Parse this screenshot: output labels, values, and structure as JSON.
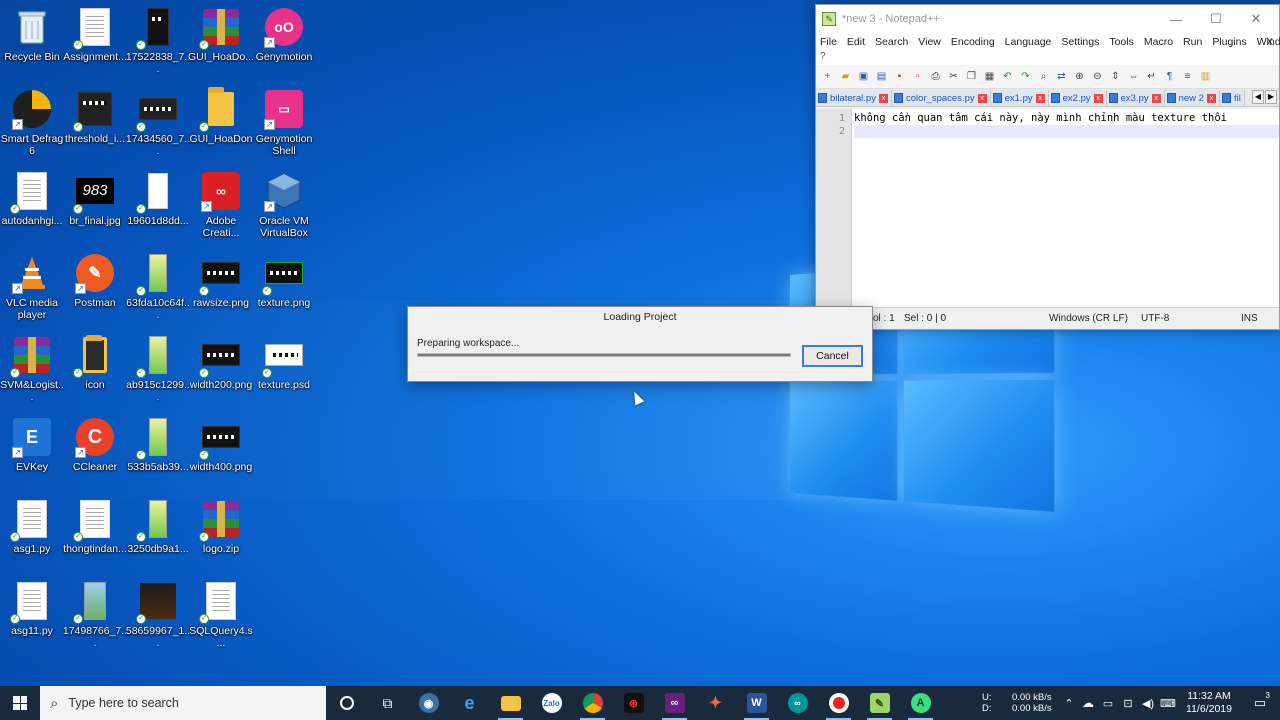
{
  "desktop": {
    "icons": [
      {
        "label": "Recycle Bin"
      },
      {
        "label": "Assignment..."
      },
      {
        "label": "17522838_7..."
      },
      {
        "label": "GUI_HoaDo..."
      },
      {
        "label": "Genymotion"
      },
      {
        "label": "Smart Defrag 6"
      },
      {
        "label": "threshold_i..."
      },
      {
        "label": "17434560_7..."
      },
      {
        "label": "GUI_HoaDon"
      },
      {
        "label": "Genymotion Shell"
      },
      {
        "label": "autodanhgi..."
      },
      {
        "label": "br_final.jpg"
      },
      {
        "label": "19601d8dd..."
      },
      {
        "label": "Adobe Creati..."
      },
      {
        "label": "Oracle VM VirtualBox"
      },
      {
        "label": "VLC media player"
      },
      {
        "label": "Postman"
      },
      {
        "label": "63fda10c64f..."
      },
      {
        "label": "rawsize.png"
      },
      {
        "label": "texture.png"
      },
      {
        "label": "SVM&Logist..."
      },
      {
        "label": "icon"
      },
      {
        "label": "ab915c1299..."
      },
      {
        "label": "width200.png"
      },
      {
        "label": "texture.psd"
      },
      {
        "label": "EVKey"
      },
      {
        "label": "CCleaner"
      },
      {
        "label": "533b5ab39..."
      },
      {
        "label": "width400.png"
      },
      {
        "label": "asg1.py"
      },
      {
        "label": "thongtindan..."
      },
      {
        "label": "3250db9a1..."
      },
      {
        "label": "logo.zip"
      },
      {
        "label": "asg11.py"
      },
      {
        "label": "17498766_7..."
      },
      {
        "label": "58659967_1..."
      },
      {
        "label": "SQLQuery4.s..."
      }
    ],
    "br_final_text": "983"
  },
  "notepad": {
    "title": "*new 3 - Notepad++",
    "menu": [
      "File",
      "Edit",
      "Search",
      "View",
      "Encoding",
      "Language",
      "Settings",
      "Tools",
      "Macro",
      "Run",
      "Plugins",
      "Window"
    ],
    "menu_help": "?",
    "menu_close": "X",
    "tabs": [
      "bilateral.py",
      "color_spaces.py",
      "ex1.py",
      "ex2.py",
      "ex3.py",
      "new 2",
      "fil"
    ],
    "line_numbers": [
      "1",
      "2"
    ],
    "lines": [
      "không cần quan tâm cái này, này mình chỉnh màu texture thôi",
      ""
    ],
    "status": {
      "pos": "ol : 1",
      "sel": "Sel : 0 | 0",
      "eol": "Windows (CR LF)",
      "enc": "UTF-8",
      "mode": "INS"
    }
  },
  "dialog": {
    "title": "Loading Project",
    "message": "Preparing workspace...",
    "progress": 1.0,
    "cancel_label": "Cancel"
  },
  "taskbar": {
    "search_placeholder": "Type here to search",
    "apps": [
      "cortana",
      "task-view",
      "vpn",
      "edge",
      "file-explorer",
      "zalo",
      "chrome",
      "app-red",
      "visual-studio",
      "app-git",
      "word",
      "arduino",
      "recorder",
      "notepadpp",
      "android-studio"
    ],
    "net_up_label": "U:",
    "net_down_label": "D:",
    "net_up": "0.00 kB/s",
    "net_down": "0.00 kB/s",
    "time": "11:32 AM",
    "date": "11/6/2019",
    "notif_count": "3"
  },
  "colors": {
    "accent": "#3c7dd8",
    "taskbar": "#1a2a3d"
  }
}
